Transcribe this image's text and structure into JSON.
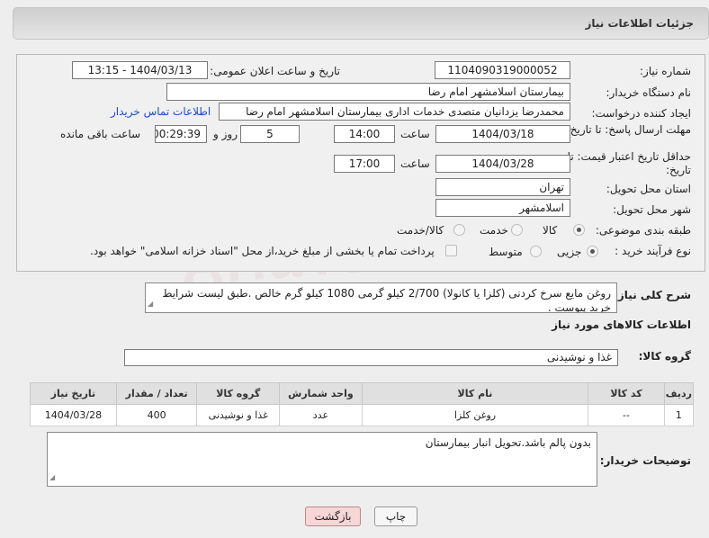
{
  "header": {
    "title": "جزئیات اطلاعات نیاز"
  },
  "fields": {
    "need_number_label": "شماره نیاز:",
    "need_number": "1104090319000052",
    "announce_label": "تاریخ و ساعت اعلان عمومی:",
    "announce_value": "1404/03/13 - 13:15",
    "buyer_label": "نام دستگاه خریدار:",
    "buyer_value": "بیمارستان اسلامشهر   امام رضا",
    "creator_label": "ایجاد کننده درخواست:",
    "creator_value": "محمدرضا یزدانیان متصدی خدمات اداری بیمارستان اسلامشهر   امام رضا",
    "contact_link": "اطلاعات تماس خریدار",
    "deadline_label": "مهلت ارسال پاسخ: تا تاریخ:",
    "deadline_date": "1404/03/18",
    "time_word": "ساعت",
    "deadline_time": "14:00",
    "days_value": "5",
    "days_word": "روز و",
    "remaining_value": "00:29:39",
    "remaining_word": "ساعت باقی مانده",
    "min_price_label": "حداقل تاریخ اعتبار قیمت: تا تاریخ:",
    "validity_date": "1404/03/28",
    "validity_time": "17:00",
    "province_label": "استان محل تحویل:",
    "province_value": "تهران",
    "city_label": "شهر محل تحویل:",
    "city_value": "اسلامشهر",
    "category_label": "طبقه بندی موضوعی:",
    "category_options": [
      "کالا",
      "خدمت",
      "کالا/خدمت"
    ],
    "process_label": "نوع فرآیند خرید :",
    "process_options": [
      "جزیی",
      "متوسط"
    ],
    "payment_note": "پرداخت تمام یا بخشی از مبلغ خرید،از محل \"اسناد خزانه اسلامی\" خواهد بود."
  },
  "description": {
    "label": "شرح کلی نیاز:",
    "text": "روغن مایع سرخ کردنی (کلزا یا کانولا) 2/700 کیلو گرمی 1080 کیلو گرم خالص .طبق لیست شرایط خرید پیوست ."
  },
  "goods": {
    "section_title": "اطلاعات کالاهای مورد نیاز",
    "group_label": "گروه کالا:",
    "group_value": "غذا و نوشیدنی",
    "columns": [
      "ردیف",
      "کد کالا",
      "نام کالا",
      "واحد شمارش",
      "گروه کالا",
      "تعداد / مقدار",
      "تاریخ نیاز"
    ],
    "rows": [
      [
        "1",
        "--",
        "روغن کلزا",
        "عدد",
        "غذا و نوشیدنی",
        "400",
        "1404/03/28"
      ]
    ]
  },
  "buyer_notes": {
    "label": "توضیحات خریدار:",
    "text": "بدون پالم باشد.تحویل انبار بیمارستان"
  },
  "buttons": {
    "print": "چاپ",
    "back": "بازگشت"
  },
  "watermark": "AriaTender.neT",
  "colors": {
    "link": "#1a4ec9",
    "back_button_bg": "#f7d6d6"
  }
}
